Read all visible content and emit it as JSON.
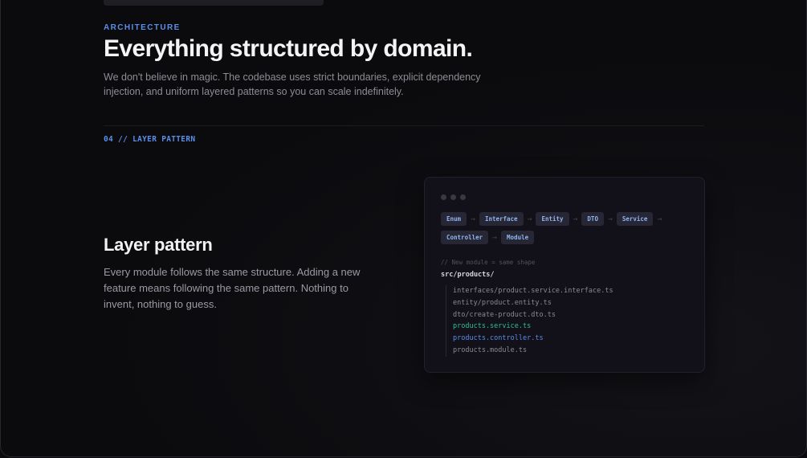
{
  "hero": {
    "eyebrow": "ARCHITECTURE",
    "title": "Everything structured by domain.",
    "description": "We don't believe in magic. The codebase uses strict boundaries, explicit dependency injection, and uniform layered patterns so you can scale indefinitely."
  },
  "section": {
    "tag": "04 // LAYER PATTERN",
    "title": "Layer pattern",
    "description": "Every module follows the same structure. Adding a new feature means following the same pattern. Nothing to invent, nothing to guess."
  },
  "code_card": {
    "layers": [
      "Enum",
      "Interface",
      "Entity",
      "DTO",
      "Service",
      "Controller",
      "Module"
    ],
    "arrow": "→",
    "comment": "// New module = same shape",
    "directory": "src/products/",
    "files": [
      {
        "name": "interfaces/product.service.interface.ts",
        "style": "default"
      },
      {
        "name": "entity/product.entity.ts",
        "style": "default"
      },
      {
        "name": "dto/create-product.dto.ts",
        "style": "default"
      },
      {
        "name": "products.service.ts",
        "style": "green"
      },
      {
        "name": "products.controller.ts",
        "style": "blue"
      },
      {
        "name": "products.module.ts",
        "style": "default"
      }
    ],
    "colors": {
      "green": "#2fbf8f",
      "blue": "#5b8ee8",
      "chip_text": "#8fb6f0",
      "accent": "#5b8ee8"
    }
  }
}
